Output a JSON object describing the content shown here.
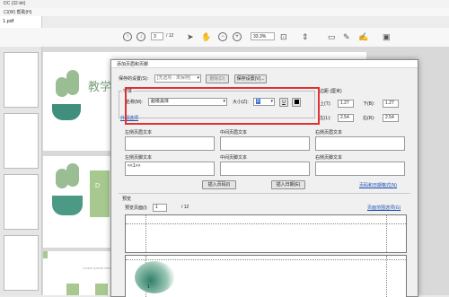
{
  "app": {
    "title_bar_text": "DC (32-bit)",
    "menu_text": "口(W)  帮助(H)",
    "tab_label": "1.pdf"
  },
  "toolbar": {
    "page_current": "3",
    "page_total": "/ 12",
    "zoom": "33.3%",
    "icons": [
      "up-arrow-icon",
      "down-arrow-icon",
      "cursor-icon",
      "hand-icon",
      "zoom-out-icon",
      "zoom-in-icon",
      "fit-page-icon",
      "scroll-icon",
      "comment-icon",
      "pen-icon",
      "sign-icon",
      "save-icon"
    ]
  },
  "document": {
    "page1_title": "教学",
    "page2_title": "D",
    "page3_text": "Lorem ipsum dolor sit"
  },
  "dialog": {
    "title": "添加页眉和页脚",
    "saved_settings_label": "保存的设置(S):",
    "saved_settings_value": "[无选项 - 未保存]",
    "delete_button": "删除(D)",
    "save_settings_button": "保存设置(V)...",
    "font_group_title": "字体",
    "font_name_label": "名称(M):",
    "font_name_value": "超级黑体",
    "font_size_label": "大小(Z):",
    "font_size_value": "8",
    "underline_button": "U",
    "appearance_link": "外观选项",
    "margin_group_title": "边距 (厘米)",
    "margin_top_label": "上(T):",
    "margin_top_value": "1.27",
    "margin_bottom_label": "下(B):",
    "margin_bottom_value": "1.27",
    "margin_left_label": "左(L):",
    "margin_left_value": "2.54",
    "margin_right_label": "右(R):",
    "margin_right_value": "2.54",
    "header_left_label": "左侧页眉文本",
    "header_center_label": "中间页眉文本",
    "header_right_label": "右侧页眉文本",
    "footer_left_label": "左侧页脚文本",
    "footer_left_value": "<<1>>",
    "footer_center_label": "中间页脚文本",
    "footer_right_label": "右侧页脚文本",
    "insert_page_number_button": "插入页码(I)",
    "insert_date_button": "插入日期(E)",
    "page_number_date_link": "页码和日期格式(N)",
    "preview_title": "预览",
    "preview_page_label": "预览页面(I)",
    "preview_page_value": "1",
    "preview_page_total": "/ 12",
    "page_range_link": "页面范围选项(G)",
    "preview_footer_number": "1"
  },
  "colors": {
    "accent_red": "#e03232",
    "link_blue": "#1e4fb3",
    "cactus_green": "#9bbd94",
    "pot_teal": "#3f8f7c"
  }
}
